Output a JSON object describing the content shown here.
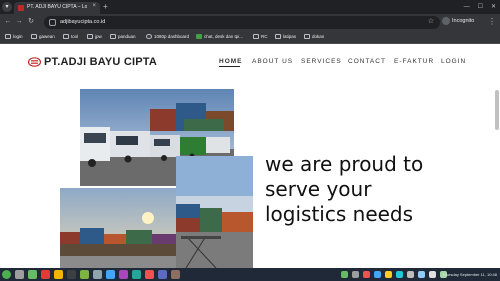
{
  "browser": {
    "tab_title": "PT. ADJI BAYU CIPTA – Lo…",
    "tab_close": "×",
    "new_tab": "+",
    "url": "adjibayucipta.co.id",
    "incognito_label": "Incognito",
    "icons": {
      "back": "back-arrow-icon",
      "forward": "forward-arrow-icon",
      "reload": "reload-icon",
      "home": "home-icon"
    },
    "bookmarks": [
      {
        "label": "login"
      },
      {
        "label": "gawean"
      },
      {
        "label": "tool"
      },
      {
        "label": "jpw"
      },
      {
        "label": "panduan"
      },
      {
        "label": "1080p dashboard"
      },
      {
        "label": "chat, desk dan tpi..."
      },
      {
        "label": "RC"
      },
      {
        "label": "latipas"
      },
      {
        "label": "dokan"
      }
    ]
  },
  "site": {
    "logo_text": "PT.ADJI BAYU CIPTA",
    "brand_color": "#c62828",
    "nav": [
      {
        "label": "HOME",
        "active": true
      },
      {
        "label": "ABOUT US",
        "active": false
      },
      {
        "label": "SERVICES",
        "active": false
      },
      {
        "label": "CONTACT",
        "active": false
      },
      {
        "label": "E-FAKTUR",
        "active": false
      },
      {
        "label": "LOGIN",
        "active": false
      }
    ],
    "headline": [
      "we are proud to",
      "serve your",
      "logistics needs"
    ]
  },
  "taskbar": {
    "clock": "Thursday September 11, 10:48"
  }
}
